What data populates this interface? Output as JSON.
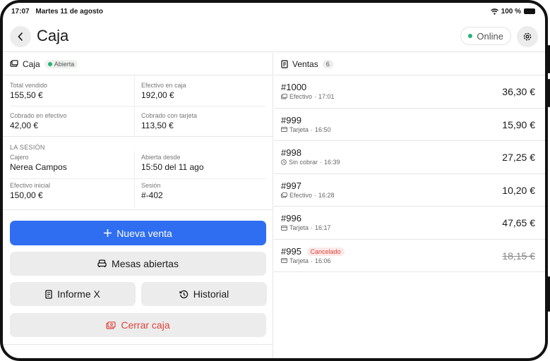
{
  "status_bar": {
    "time": "17:07",
    "date": "Martes 11 de agosto",
    "battery": "100 %"
  },
  "header": {
    "title": "Caja",
    "online_label": "Online"
  },
  "left": {
    "title": "Caja",
    "state_badge": "Abierta",
    "stats": [
      [
        {
          "label": "Total vendido",
          "value": "155,50 €"
        },
        {
          "label": "Efectivo en caja",
          "value": "192,00 €"
        }
      ],
      [
        {
          "label": "Cobrado en efectivo",
          "value": "42,00 €"
        },
        {
          "label": "Cobrado con tarjeta",
          "value": "113,50 €"
        }
      ]
    ],
    "session_label": "LA SESIÓN",
    "session": [
      [
        {
          "label": "Cajero",
          "value": "Nerea Campos"
        },
        {
          "label": "Abierta desde",
          "value": "15:50 del 11 ago"
        }
      ],
      [
        {
          "label": "Efectivo inicial",
          "value": "150,00 €"
        },
        {
          "label": "Sesión",
          "value": "#-402"
        }
      ]
    ],
    "buttons": {
      "new_sale": "Nueva venta",
      "open_tables": "Mesas abiertas",
      "report_x": "Informe X",
      "history": "Historial",
      "close_register": "Cerrar caja"
    }
  },
  "right": {
    "title": "Ventas",
    "count": "6",
    "sales": [
      {
        "number": "#1000",
        "method": "Efectivo",
        "time": "17:01",
        "amount": "36,30 €",
        "icon": "cash-icon",
        "cancelled": ""
      },
      {
        "number": "#999",
        "method": "Tarjeta",
        "time": "16:50",
        "amount": "15,90 €",
        "icon": "card-icon",
        "cancelled": ""
      },
      {
        "number": "#998",
        "method": "Sin cobrar",
        "time": "16:39",
        "amount": "27,25 €",
        "icon": "clock-icon",
        "cancelled": ""
      },
      {
        "number": "#997",
        "method": "Efectivo",
        "time": "16:28",
        "amount": "10,20 €",
        "icon": "cash-icon",
        "cancelled": ""
      },
      {
        "number": "#996",
        "method": "Tarjeta",
        "time": "16:17",
        "amount": "47,65 €",
        "icon": "card-icon",
        "cancelled": ""
      },
      {
        "number": "#995",
        "method": "Tarjeta",
        "time": "16:06",
        "amount": "18,15 €",
        "icon": "card-icon",
        "cancelled": "Cancelado"
      }
    ]
  },
  "colors": {
    "primary": "#2f6ef1",
    "online": "#22b573",
    "danger": "#e0433a"
  }
}
